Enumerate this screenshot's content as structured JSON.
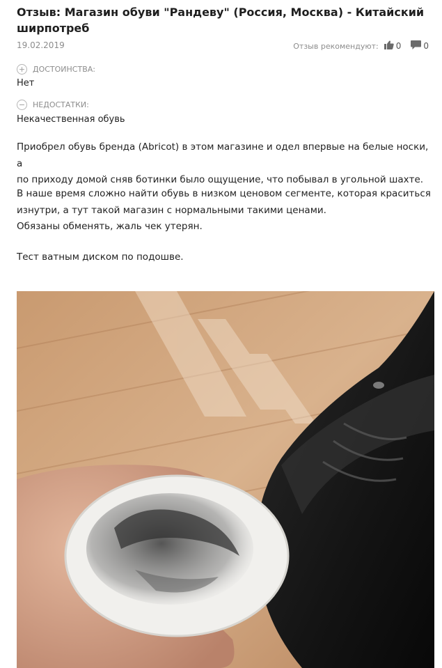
{
  "review": {
    "title": "Отзыв: Магазин обуви \"Рандеву\" (Россия, Москва) - Китайский ширпотреб",
    "date": "19.02.2019",
    "recommend_label": "Отзыв рекомендуют:",
    "likes": "0",
    "comments": "0"
  },
  "pros": {
    "label": "ДОСТОИНСТВА:",
    "text": "Нет",
    "icon": "plus-circle-icon"
  },
  "cons": {
    "label": "НЕДОСТАТКИ:",
    "text": "Некачественная обувь",
    "icon": "minus-circle-icon"
  },
  "body": {
    "p1_line1": "Приобрел обувь бренда (Abricot) в этом магазине и одел впервые на белые носки, а",
    "p1_line2": "по приходу домой сняв ботинки было ощущение, что побывал в угольной шахте.",
    "p2_line1": "В наше время сложно найти обувь в низком ценовом сегменте, которая краситься",
    "p2_line2": "изнутри, а тут такой магазин с нормальными такими ценами.",
    "p2_line3": "Обязаны обменять, жаль чек утерян.",
    "p3": "Тест ватным диском по подошве."
  },
  "colors": {
    "title": "#1f1f1f",
    "muted": "#8c8c8c",
    "text": "#222222"
  },
  "icons": [
    "thumbs-up-icon",
    "comment-icon",
    "plus-circle-icon",
    "minus-circle-icon"
  ]
}
